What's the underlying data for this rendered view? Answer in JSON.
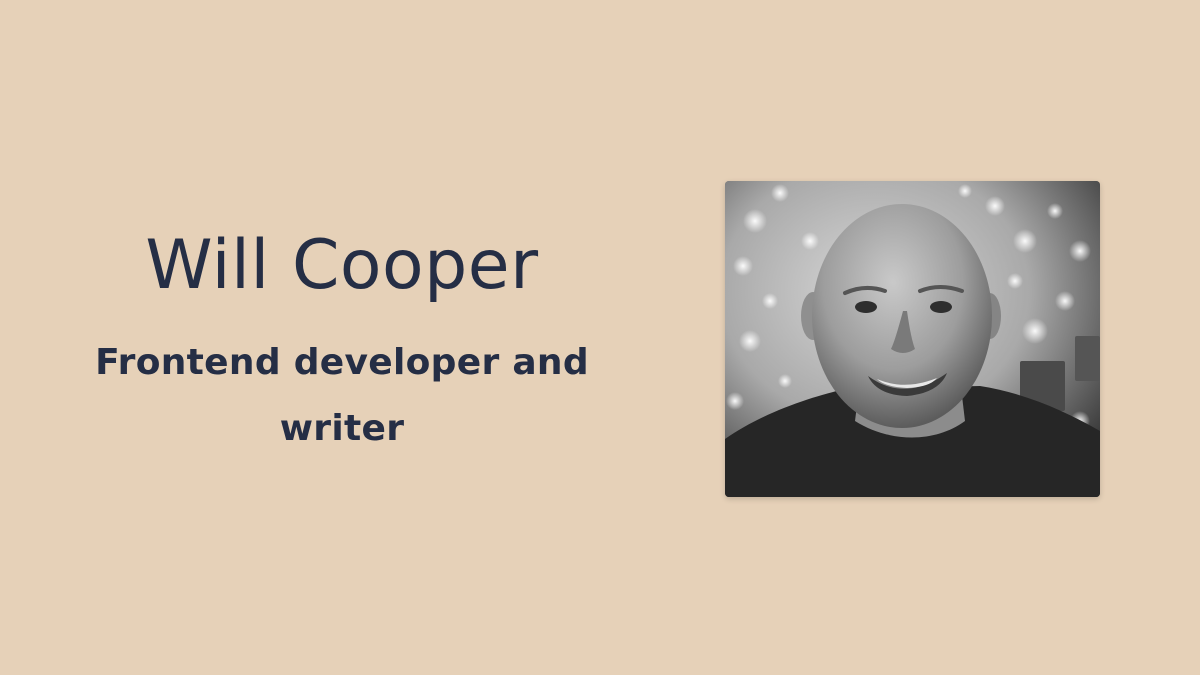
{
  "profile": {
    "name": "Will Cooper",
    "tagline": "Frontend developer and writer"
  },
  "colors": {
    "background": "#e6d1b8",
    "text": "#252e45"
  },
  "portrait": {
    "description_icon": "portrait-photo"
  }
}
